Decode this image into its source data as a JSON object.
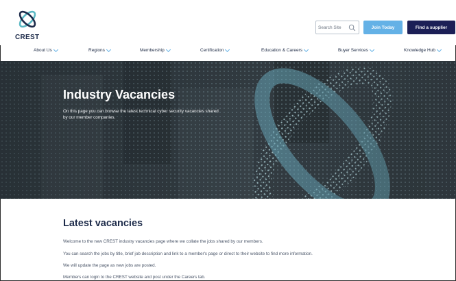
{
  "header": {
    "logo_text": "CREST",
    "search_placeholder": "Search Site",
    "join_label": "Join Today",
    "supplier_label": "Find a supplier"
  },
  "nav": {
    "items": [
      {
        "label": "About Us"
      },
      {
        "label": "Regions"
      },
      {
        "label": "Membership"
      },
      {
        "label": "Certification"
      },
      {
        "label": "Education & Careers"
      },
      {
        "label": "Buyer Services"
      },
      {
        "label": "Knowledge Hub"
      }
    ]
  },
  "hero": {
    "title": "Industry Vacancies",
    "description": "On this page you can browse the latest technical cyber security vacancies shared by our member companies."
  },
  "main": {
    "title": "Latest vacancies",
    "paragraphs": [
      "Welcome to the new CREST industry vacancies page where we collate the jobs shared by our members.",
      "You can search the jobs by title, brief job description and link to a member's page or direct to their website to find more information.",
      "We will update the page as new jobs are posted.",
      "Members can login to the CREST website and post under the Careers tab."
    ]
  },
  "colors": {
    "brand_navy": "#1c1f56",
    "accent_blue": "#64b1e6",
    "logo_teal": "#5bb8c4"
  }
}
